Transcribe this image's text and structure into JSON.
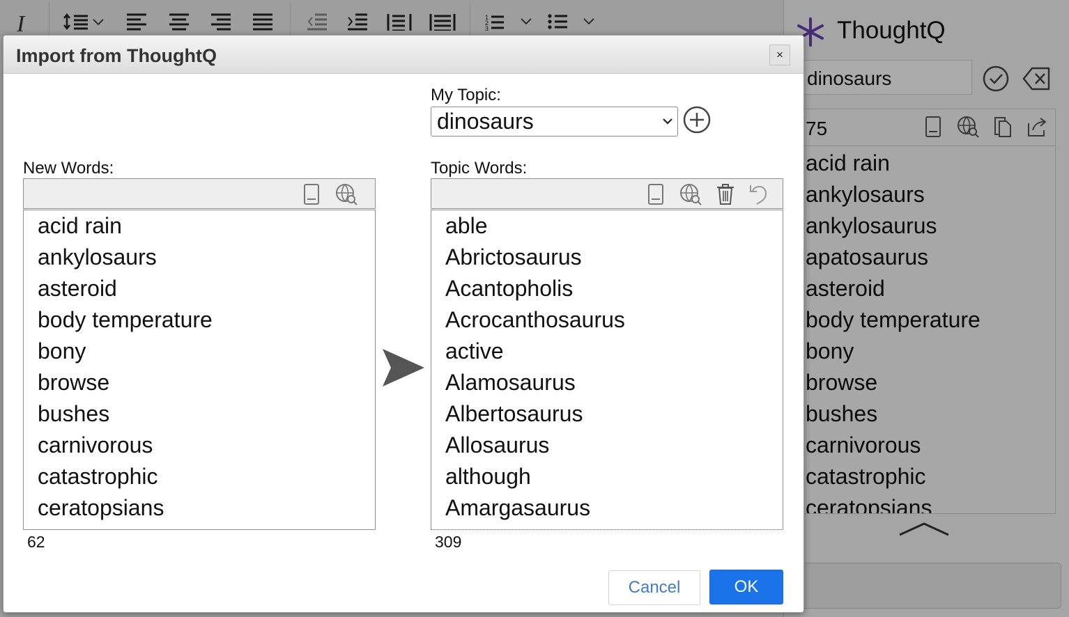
{
  "background": {
    "side_panel": {
      "app_name": "ThoughtQ",
      "search_value": "dinosaurs",
      "word_count": "75",
      "words": [
        "acid rain",
        "ankylosaurs",
        "ankylosaurus",
        "apatosaurus",
        "asteroid",
        "body temperature",
        "bony",
        "browse",
        "bushes",
        "carnivorous",
        "catastrophic",
        "ceratopsians"
      ]
    }
  },
  "dialog": {
    "title": "Import from ThoughtQ",
    "close_label": "×",
    "my_topic_label": "My Topic:",
    "topic_selected": "dinosaurs",
    "new_words_label": "New Words:",
    "topic_words_label": "Topic Words:",
    "new_words": [
      "acid rain",
      "ankylosaurs",
      "asteroid",
      "body temperature",
      "bony",
      "browse",
      "bushes",
      "carnivorous",
      "catastrophic",
      "ceratopsians"
    ],
    "new_words_count": "62",
    "topic_words": [
      "able",
      "Abrictosaurus",
      "Acantopholis",
      "Acrocanthosaurus",
      "active",
      "Alamosaurus",
      "Albertosaurus",
      "Allosaurus",
      "although",
      "Amargasaurus"
    ],
    "topic_words_count": "309",
    "cancel_label": "Cancel",
    "ok_label": "OK"
  },
  "colors": {
    "accent": "#1a73e8",
    "logo": "#6a3fb3"
  }
}
